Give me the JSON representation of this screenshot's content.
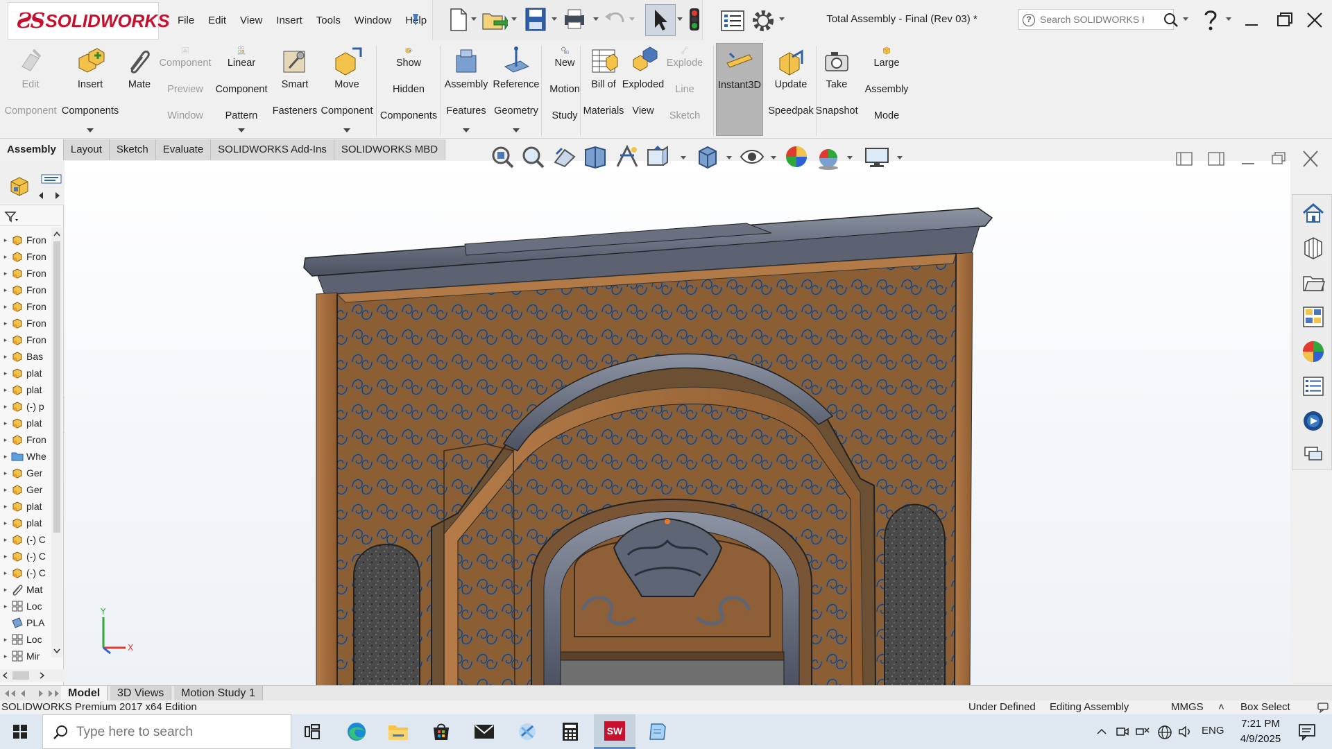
{
  "app": {
    "brand": "SOLIDWORKS",
    "document_title": "Total Assembly - Final (Rev 03) *"
  },
  "menu": [
    "File",
    "Edit",
    "View",
    "Insert",
    "Tools",
    "Window",
    "Help"
  ],
  "help_search": {
    "placeholder": "Search SOLIDWORKS Help"
  },
  "commands": [
    {
      "id": "edit-component",
      "label": "Edit Component",
      "lines": [
        "Edit",
        "Component"
      ],
      "disabled": true
    },
    {
      "id": "insert-components",
      "label": "Insert Components",
      "lines": [
        "Insert",
        "Components"
      ]
    },
    {
      "id": "mate",
      "label": "Mate",
      "lines": [
        "Mate"
      ]
    },
    {
      "id": "component-preview-window",
      "label": "Component Preview Window",
      "lines": [
        "Component",
        "Preview",
        "Window"
      ],
      "disabled": true
    },
    {
      "id": "linear-component-pattern",
      "label": "Linear Component Pattern",
      "lines": [
        "Linear",
        "Component",
        "Pattern"
      ]
    },
    {
      "id": "smart-fasteners",
      "label": "Smart Fasteners",
      "lines": [
        "Smart",
        "Fasteners"
      ]
    },
    {
      "id": "move-component",
      "label": "Move Component",
      "lines": [
        "Move",
        "Component"
      ]
    },
    {
      "id": "show-hidden-components",
      "label": "Show Hidden Components",
      "lines": [
        "Show",
        "Hidden",
        "Components"
      ]
    },
    {
      "id": "assembly-features",
      "label": "Assembly Features",
      "lines": [
        "Assembly",
        "Features"
      ]
    },
    {
      "id": "reference-geometry",
      "label": "Reference Geometry",
      "lines": [
        "Reference",
        "Geometry"
      ]
    },
    {
      "id": "new-motion-study",
      "label": "New Motion Study",
      "lines": [
        "New",
        "Motion",
        "Study"
      ]
    },
    {
      "id": "bill-of-materials",
      "label": "Bill of Materials",
      "lines": [
        "Bill of",
        "Materials"
      ]
    },
    {
      "id": "exploded-view",
      "label": "Exploded View",
      "lines": [
        "Exploded",
        "View"
      ]
    },
    {
      "id": "explode-line-sketch",
      "label": "Explode Line Sketch",
      "lines": [
        "Explode",
        "Line",
        "Sketch"
      ],
      "disabled": true
    },
    {
      "id": "instant3d",
      "label": "Instant3D",
      "lines": [
        "Instant3D"
      ],
      "active": true
    },
    {
      "id": "update-speedpak",
      "label": "Update Speedpak",
      "lines": [
        "Update",
        "Speedpak"
      ]
    },
    {
      "id": "take-snapshot",
      "label": "Take Snapshot",
      "lines": [
        "Take",
        "Snapshot"
      ]
    },
    {
      "id": "large-assembly-mode",
      "label": "Large Assembly Mode",
      "lines": [
        "Large",
        "Assembly",
        "Mode"
      ]
    }
  ],
  "cm_tabs": [
    "Assembly",
    "Layout",
    "Sketch",
    "Evaluate",
    "SOLIDWORKS Add-Ins",
    "SOLIDWORKS MBD"
  ],
  "cm_tab_active": "Assembly",
  "feature_tree": [
    {
      "label": "Fron",
      "icon": "part-icon"
    },
    {
      "label": "Fron",
      "icon": "part-icon"
    },
    {
      "label": "Fron",
      "icon": "part-icon"
    },
    {
      "label": "Fron",
      "icon": "part-icon"
    },
    {
      "label": "Fron",
      "icon": "part-icon"
    },
    {
      "label": "Fron",
      "icon": "part-icon"
    },
    {
      "label": "Fron",
      "icon": "part-icon"
    },
    {
      "label": "Bas",
      "icon": "part-icon"
    },
    {
      "label": "plat",
      "icon": "part-icon"
    },
    {
      "label": "plat",
      "icon": "part-icon"
    },
    {
      "label": "(-) p",
      "icon": "part-icon"
    },
    {
      "label": "plat",
      "icon": "part-icon"
    },
    {
      "label": "Fron",
      "icon": "part-icon"
    },
    {
      "label": "Whe",
      "icon": "folder-icon"
    },
    {
      "label": "Ger",
      "icon": "part-icon"
    },
    {
      "label": "Ger",
      "icon": "part-icon"
    },
    {
      "label": "plat",
      "icon": "part-icon"
    },
    {
      "label": "plat",
      "icon": "part-icon"
    },
    {
      "label": "(-) C",
      "icon": "part-icon"
    },
    {
      "label": "(-) C",
      "icon": "part-icon"
    },
    {
      "label": "(-) C",
      "icon": "part-icon"
    },
    {
      "label": "Mat",
      "icon": "mates-icon"
    },
    {
      "label": "Loc",
      "icon": "pattern-icon"
    },
    {
      "label": "PLA",
      "icon": "plane-icon"
    },
    {
      "label": "Loc",
      "icon": "pattern-icon"
    },
    {
      "label": "Mir",
      "icon": "pattern-icon"
    }
  ],
  "triad": {
    "x": "X",
    "y": "Y"
  },
  "model_tabs": [
    "Model",
    "3D Views",
    "Motion Study 1"
  ],
  "model_tab_active": "Model",
  "status": {
    "edition": "SOLIDWORKS Premium 2017 x64 Edition",
    "definition": "Under Defined",
    "mode": "Editing Assembly",
    "units": "MMGS",
    "units_arrow": "˄",
    "select": "Box Select"
  },
  "taskbar": {
    "search_placeholder": "Type here to search",
    "language": "ENG",
    "time": "7:21 PM",
    "date": "4/9/2025"
  },
  "colors": {
    "brand_red": "#c8102e",
    "wood": "#a6703f",
    "metal": "#5d6474",
    "granite": "#4a4a4a"
  }
}
